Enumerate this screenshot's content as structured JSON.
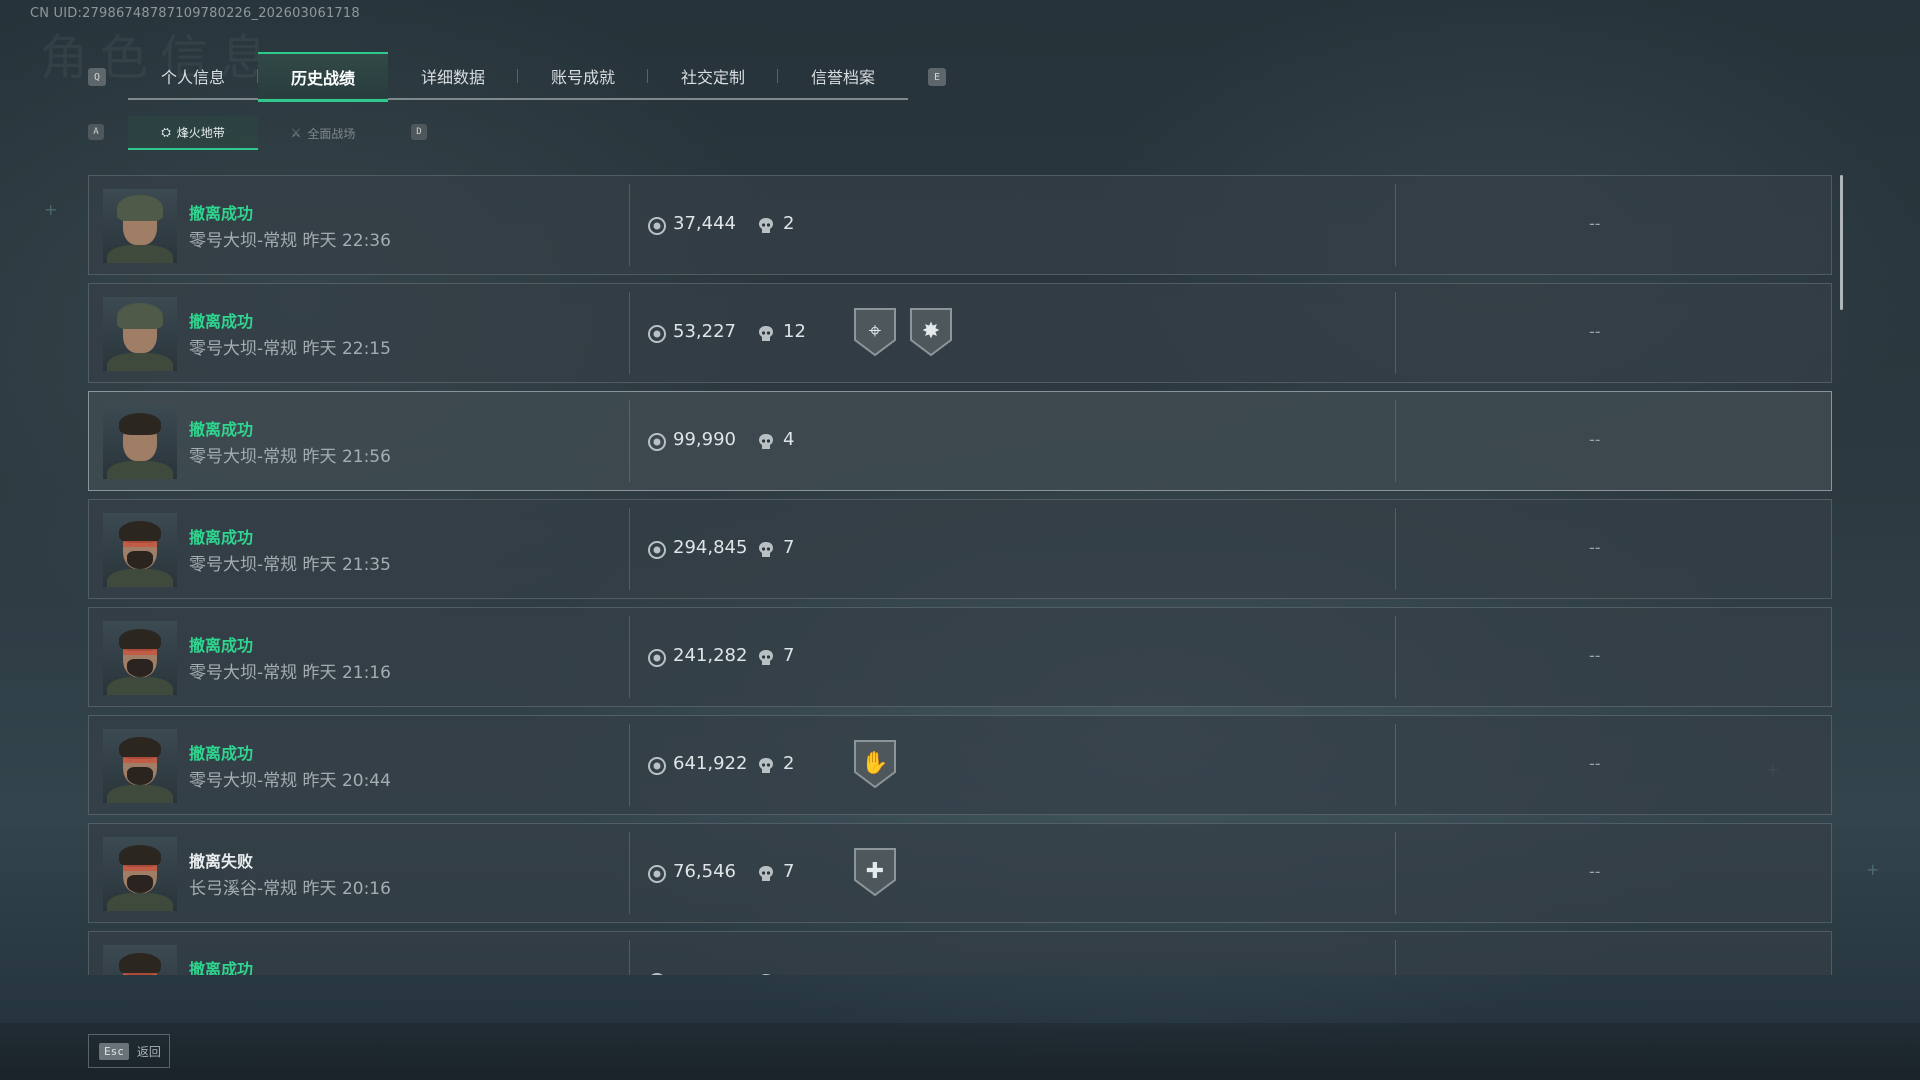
{
  "uid_text": "CN UID:27986748787109780226_202603061718",
  "header": {
    "left_key": "Q",
    "right_key": "E",
    "tabs": [
      {
        "label": "个人信息"
      },
      {
        "label": "历史战绩"
      },
      {
        "label": "详细数据"
      },
      {
        "label": "账号成就"
      },
      {
        "label": "社交定制"
      },
      {
        "label": "信誉档案"
      }
    ],
    "active_tab": "历史战绩"
  },
  "subheader": {
    "left_key": "A",
    "right_key": "D",
    "tabs": [
      {
        "label": "烽火地带",
        "icon": "fire-zone-icon"
      },
      {
        "label": "全面战场",
        "icon": "battlefield-icon"
      }
    ],
    "active_tab": "烽火地带"
  },
  "matches": [
    {
      "status": "撤离成功",
      "success": true,
      "map_mode": "零号大坝-常规",
      "time": "昨天 22:36",
      "value": "37,444",
      "kills": "2",
      "badges": [],
      "extra": "--",
      "avatar": "female-helmet"
    },
    {
      "status": "撤离成功",
      "success": true,
      "map_mode": "零号大坝-常规",
      "time": "昨天 22:15",
      "value": "53,227",
      "kills": "12",
      "badges": [
        "crosshair-badge-icon",
        "explosion-badge-icon"
      ],
      "extra": "--",
      "avatar": "female-helmet"
    },
    {
      "status": "撤离成功",
      "success": true,
      "map_mode": "零号大坝-常规",
      "time": "昨天 21:56",
      "value": "99,990",
      "kills": "4",
      "badges": [],
      "extra": "--",
      "avatar": "female-hair"
    },
    {
      "status": "撤离成功",
      "success": true,
      "map_mode": "零号大坝-常规",
      "time": "昨天 21:35",
      "value": "294,845",
      "kills": "7",
      "badges": [],
      "extra": "--",
      "avatar": "male-beard"
    },
    {
      "status": "撤离成功",
      "success": true,
      "map_mode": "零号大坝-常规",
      "time": "昨天 21:16",
      "value": "241,282",
      "kills": "7",
      "badges": [],
      "extra": "--",
      "avatar": "male-beard"
    },
    {
      "status": "撤离成功",
      "success": true,
      "map_mode": "零号大坝-常规",
      "time": "昨天 20:44",
      "value": "641,922",
      "kills": "2",
      "badges": [
        "handshake-badge-icon"
      ],
      "extra": "--",
      "avatar": "male-beard"
    },
    {
      "status": "撤离失败",
      "success": false,
      "map_mode": "长弓溪谷-常规",
      "time": "昨天 20:16",
      "value": "76,546",
      "kills": "7",
      "badges": [
        "rescue-badge-icon"
      ],
      "extra": "--",
      "avatar": "male-beard"
    },
    {
      "status": "撤离成功",
      "success": true,
      "map_mode": "",
      "time": "",
      "value": "",
      "kills": "",
      "badges": [],
      "extra": "",
      "avatar": "male-spiky"
    }
  ],
  "footer": {
    "esc_key": "Esc",
    "back_label": "返回"
  },
  "colors": {
    "accent": "#2fc98e",
    "success": "#2fd58f",
    "fail": "#e8ecee"
  }
}
